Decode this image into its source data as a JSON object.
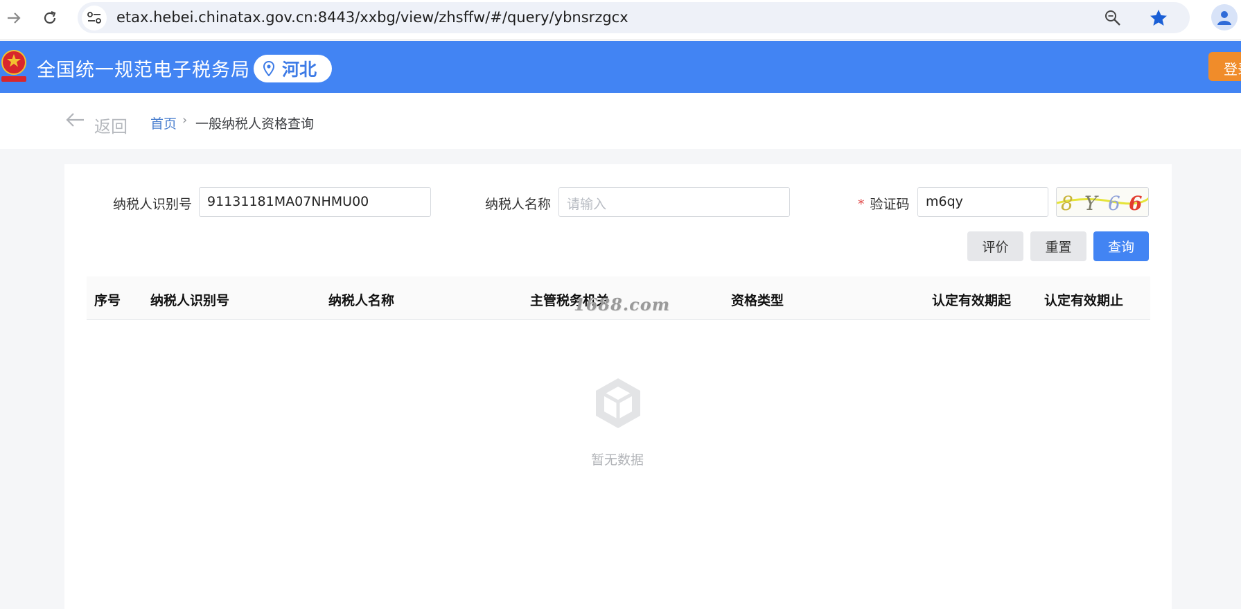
{
  "browser": {
    "url": "etax.hebei.chinatax.gov.cn:8443/xxbg/view/zhsffw/#/query/ybnsrzgcx",
    "icons": [
      "forward-icon",
      "reload-icon",
      "site-info-icon",
      "zoom-icon",
      "bookmark-star-icon",
      "profile-icon"
    ]
  },
  "header": {
    "title": "全国统一规范电子税务局",
    "region": "河北",
    "login_label": "登录",
    "colors": {
      "brand": "#4284f3",
      "login": "#f08c2a"
    }
  },
  "breadcrumb": {
    "back_label": "返回",
    "home": "首页",
    "separator": "›",
    "current": "一般纳税人资格查询"
  },
  "form": {
    "taxpayer_id_label": "纳税人识别号",
    "taxpayer_id_value": "91131181MA07NHMU00",
    "taxpayer_name_label": "纳税人名称",
    "taxpayer_name_placeholder": "请输入",
    "captcha_label": "验证码",
    "captcha_required_mark": "*",
    "captcha_value": "m6qy",
    "captcha_image_text": "8Y66"
  },
  "buttons": {
    "evaluate": "评价",
    "reset": "重置",
    "query": "查询"
  },
  "table": {
    "columns": [
      "序号",
      "纳税人识别号",
      "纳税人名称",
      "主管税务机关",
      "资格类型",
      "认定有效期起",
      "认定有效期止"
    ],
    "rows": [],
    "empty_text": "暂无数据"
  },
  "watermark": "1688.com"
}
